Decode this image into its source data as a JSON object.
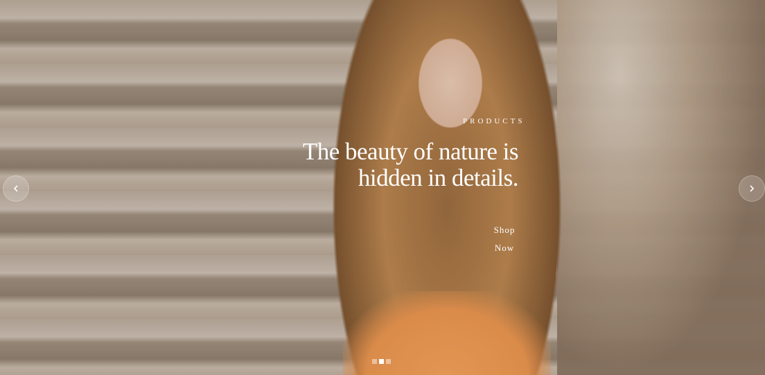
{
  "hero": {
    "eyebrow": "PRODUCTS",
    "headline_line1": "The beauty of nature is",
    "headline_line2": "hidden in details.",
    "cta_line1": "Shop",
    "cta_line2": "Now",
    "image_alt": "woman with long wavy hair in front of stone stairs"
  },
  "navigation": {
    "prev_icon": "chevron-left-icon",
    "next_icon": "chevron-right-icon"
  },
  "slider": {
    "slide_count": 3,
    "active_slide": 2
  },
  "colors": {
    "text": "#ffffff",
    "top_accent": "#f1a05a"
  }
}
